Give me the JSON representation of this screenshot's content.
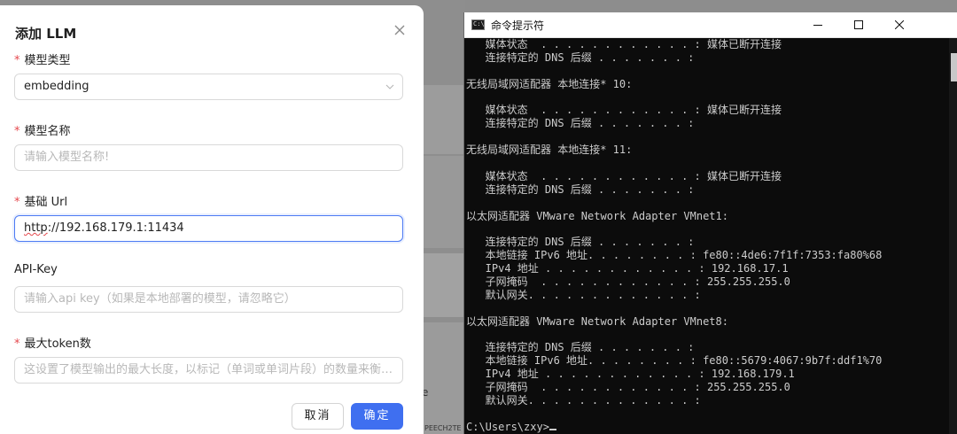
{
  "background": {
    "left_text": "e",
    "bottom_text": "PEECH2TE"
  },
  "modal": {
    "title": "添加 LLM",
    "fields": [
      {
        "label": "模型类型",
        "required": true,
        "value": "embedding",
        "placeholder": "",
        "type": "select"
      },
      {
        "label": "模型名称",
        "required": true,
        "value": "",
        "placeholder": "请输入模型名称!",
        "type": "input"
      },
      {
        "label": "基础 Url",
        "required": true,
        "value": "http://192.168.179.1:11434",
        "placeholder": "",
        "type": "input",
        "focused": true
      },
      {
        "label": "API-Key",
        "required": false,
        "value": "",
        "placeholder": "请输入api key（如果是本地部署的模型，请忽略它）",
        "type": "input"
      },
      {
        "label": "最大token数",
        "required": true,
        "value": "",
        "placeholder": "这设置了模型输出的最大长度，以标记（单词或单词片段）的数量来衡量。",
        "type": "input"
      }
    ],
    "required_mark": "*",
    "url_prefix": "http",
    "url_rest": "://192.168.179.1:11434",
    "cancel_label": "取消",
    "ok_label": "确定",
    "accent_color": "#3f6ff0"
  },
  "cmd": {
    "title": "命令提示符",
    "icon_text": "C:\\",
    "lines": [
      "   媒体状态  . . . . . . . . . . . . : 媒体已断开连接",
      "   连接特定的 DNS 后缀 . . . . . . . :",
      "",
      "无线局域网适配器 本地连接* 10:",
      "",
      "   媒体状态  . . . . . . . . . . . . : 媒体已断开连接",
      "   连接特定的 DNS 后缀 . . . . . . . :",
      "",
      "无线局域网适配器 本地连接* 11:",
      "",
      "   媒体状态  . . . . . . . . . . . . : 媒体已断开连接",
      "   连接特定的 DNS 后缀 . . . . . . . :",
      "",
      "以太网适配器 VMware Network Adapter VMnet1:",
      "",
      "   连接特定的 DNS 后缀 . . . . . . . :",
      "   本地链接 IPv6 地址. . . . . . . . : fe80::4de6:7f1f:7353:fa80%68",
      "   IPv4 地址 . . . . . . . . . . . . : 192.168.17.1",
      "   子网掩码  . . . . . . . . . . . . : 255.255.255.0",
      "   默认网关. . . . . . . . . . . . . :",
      "",
      "以太网适配器 VMware Network Adapter VMnet8:",
      "",
      "   连接特定的 DNS 后缀 . . . . . . . :",
      "   本地链接 IPv6 地址. . . . . . . . : fe80::5679:4067:9b7f:ddf1%70",
      "   IPv4 地址 . . . . . . . . . . . . : 192.168.179.1",
      "   子网掩码  . . . . . . . . . . . . : 255.255.255.0",
      "   默认网关. . . . . . . . . . . . . :",
      "",
      "C:\\Users\\zxy>"
    ]
  }
}
